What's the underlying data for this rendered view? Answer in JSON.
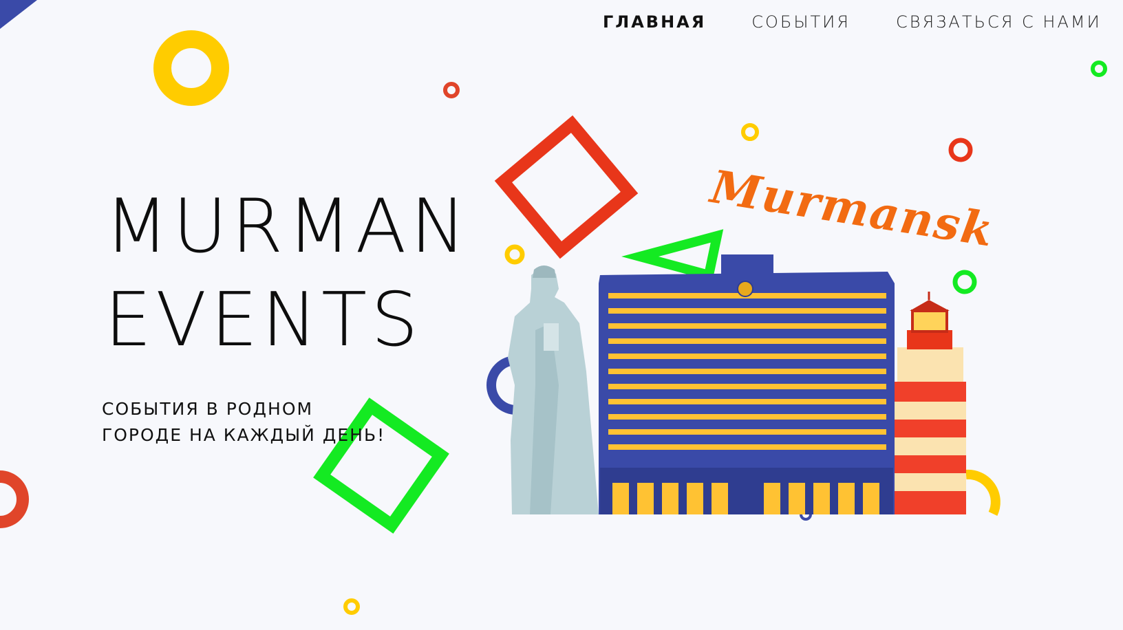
{
  "nav": {
    "items": [
      {
        "label": "ГЛАВНАЯ",
        "active": true
      },
      {
        "label": "СОБЫТИЯ",
        "active": false
      },
      {
        "label": "СВЯЗАТЬСЯ С НАМИ",
        "active": false
      }
    ]
  },
  "hero": {
    "title_line1": "MURMAN",
    "title_line2": "EVENTS",
    "subtitle_line1": "СОБЫТИЯ В РОДНОМ",
    "subtitle_line2": "ГОРОДЕ НА КАЖДЫЙ ДЕНЬ!"
  },
  "illustration": {
    "city_label": "Murmansk",
    "icons": [
      "soldier-statue-icon",
      "hotel-arctic-building-icon",
      "lighthouse-icon"
    ]
  },
  "colors": {
    "background": "#f7f8fc",
    "accent_blue": "#3a4aa8",
    "accent_yellow": "#ffcc00",
    "accent_red": "#e8361a",
    "accent_green": "#14ea22",
    "accent_orange": "#f26b12"
  }
}
